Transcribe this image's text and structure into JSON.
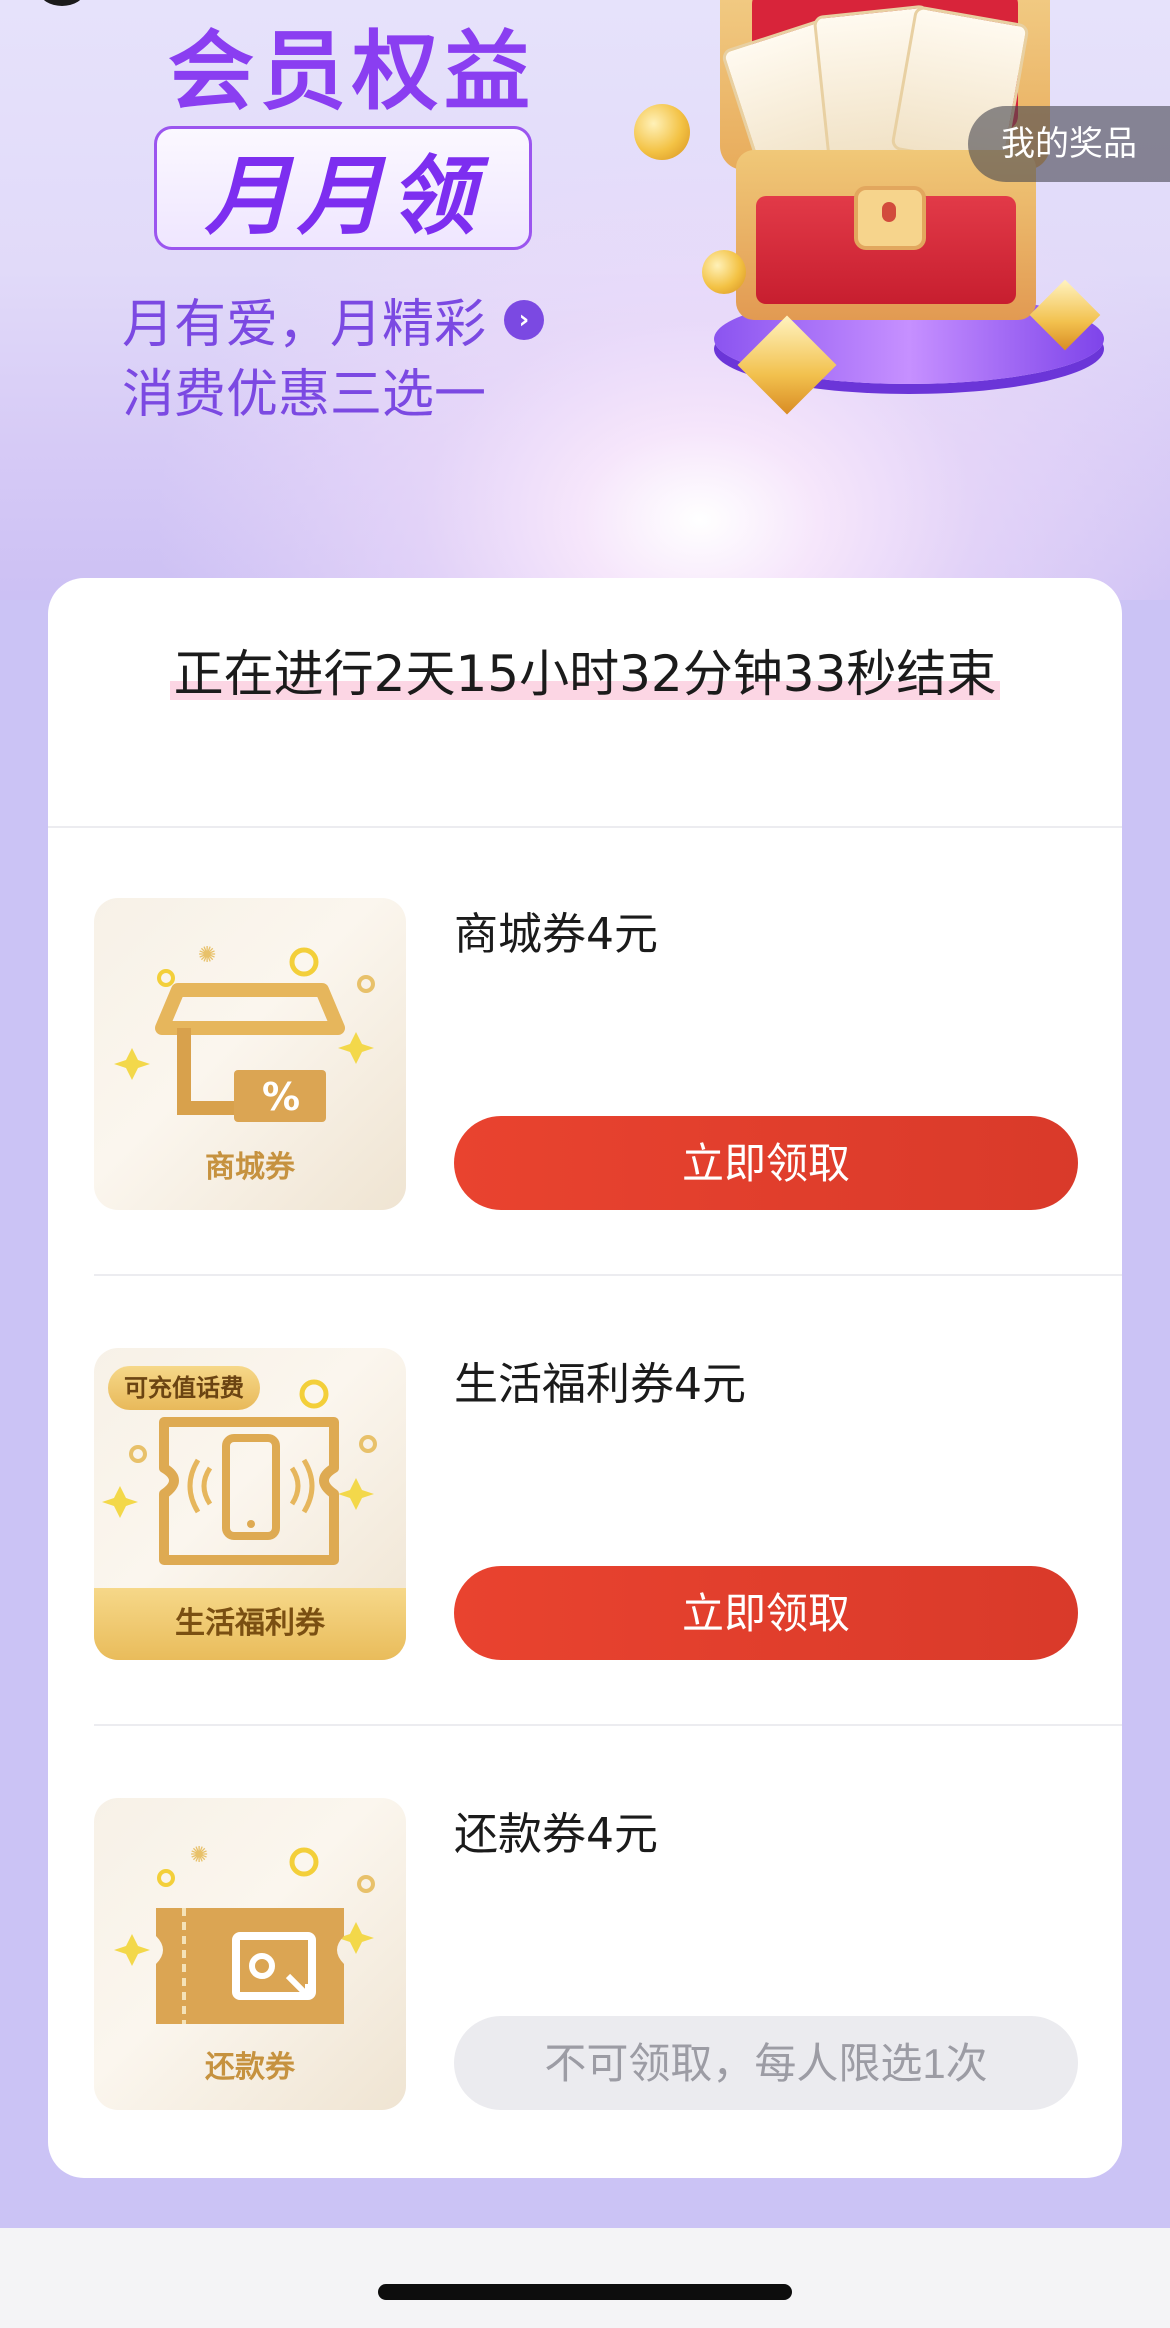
{
  "banner": {
    "title": "会员权益",
    "ribbon_text": "月月领",
    "subtitle_line1": "月有爱，月精彩",
    "subtitle_arrow": "›",
    "subtitle_line2": "消费优惠三选一",
    "my_prizes_label": "我的奖品"
  },
  "countdown": {
    "text": "正在进行2天15小时32分钟33秒结束"
  },
  "items": [
    {
      "title": "商城券4元",
      "thumb_caption": "商城券",
      "thumb_tag": "",
      "button_label": "立即领取",
      "button_state": "enabled"
    },
    {
      "title": "生活福利券4元",
      "thumb_caption": "生活福利券",
      "thumb_tag": "可充值话费",
      "button_label": "立即领取",
      "button_state": "enabled"
    },
    {
      "title": "还款券4元",
      "thumb_caption": "还款券",
      "thumb_tag": "",
      "button_label": "不可领取，每人限选1次",
      "button_state": "disabled"
    }
  ],
  "colors": {
    "brand_purple": "#8a3ef1",
    "button_red": "#e3402d",
    "disabled_gray": "#ebebef",
    "gold": "#c6923f"
  }
}
